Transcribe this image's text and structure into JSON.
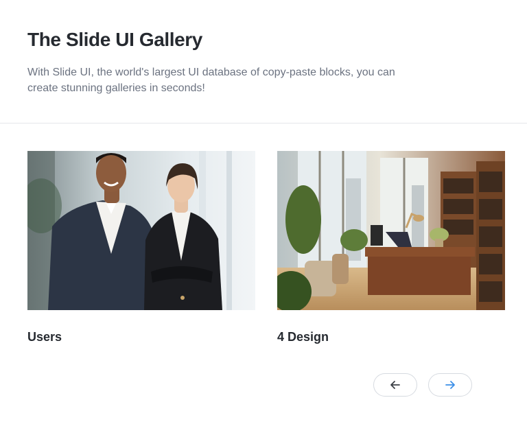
{
  "header": {
    "title": "The Slide UI Gallery",
    "description": "With Slide UI, the world's largest UI database of copy-paste blocks, you can create stunning galleries in seconds!"
  },
  "gallery": {
    "items": [
      {
        "label": "Users",
        "image": "photo of two business people smiling in an office"
      },
      {
        "label": "4 Design",
        "image": "photo of a sunlit office interior with desk, plants and bookshelves"
      }
    ]
  },
  "navigation": {
    "prev_icon": "arrow-left-icon",
    "next_icon": "arrow-right-icon",
    "prev_color": "#3b3f45",
    "next_color": "#3b8ee8"
  }
}
